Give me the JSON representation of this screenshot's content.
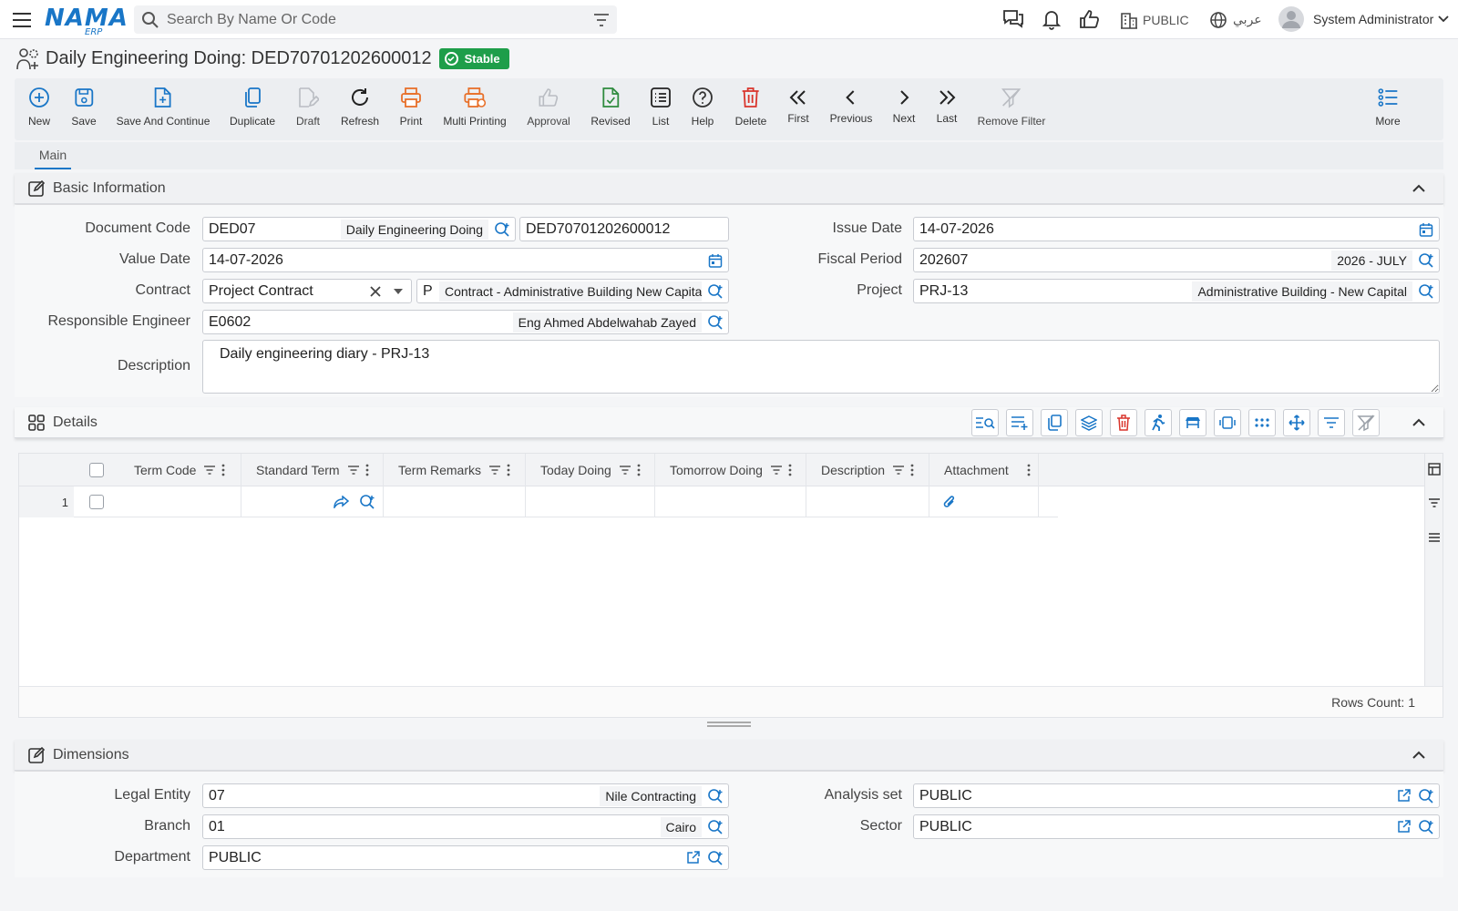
{
  "app": {
    "logo": "NAMA",
    "logo_sub": "ERP",
    "search_placeholder": "Search By Name Or Code",
    "org": "PUBLIC",
    "language": "عربي",
    "user": "System Administrator"
  },
  "page": {
    "title": "Daily Engineering Doing: DED70701202600012",
    "status": "Stable"
  },
  "toolbar": {
    "new": "New",
    "save": "Save",
    "save_continue": "Save And Continue",
    "duplicate": "Duplicate",
    "draft": "Draft",
    "refresh": "Refresh",
    "print": "Print",
    "multi_printing": "Multi Printing",
    "approval": "Approval",
    "revised": "Revised",
    "list": "List",
    "help": "Help",
    "delete": "Delete",
    "first": "First",
    "previous": "Previous",
    "next": "Next",
    "last": "Last",
    "remove_filter": "Remove Filter",
    "more": "More"
  },
  "tabs": {
    "main": "Main"
  },
  "basic": {
    "title": "Basic Information",
    "document_code": {
      "label": "Document Code",
      "code": "DED07",
      "name": "Daily Engineering Doing",
      "number": "DED70701202600012"
    },
    "issue_date": {
      "label": "Issue Date",
      "value": "14-07-2026"
    },
    "value_date": {
      "label": "Value Date",
      "value": "14-07-2026"
    },
    "fiscal_period": {
      "label": "Fiscal Period",
      "value": "202607",
      "name": "2026 - JULY"
    },
    "contract": {
      "label": "Contract",
      "type": "Project Contract",
      "prefix": "P",
      "name": "Contract - Administrative Building New Capital"
    },
    "project": {
      "label": "Project",
      "value": "PRJ-13",
      "name": "Administrative Building - New Capital"
    },
    "engineer": {
      "label": "Responsible Engineer",
      "value": "E0602",
      "name": "Eng Ahmed Abdelwahab Zayed"
    },
    "description": {
      "label": "Description",
      "value": "Daily engineering diary - PRJ-13"
    }
  },
  "details": {
    "title": "Details",
    "columns": [
      "Term Code",
      "Standard Term",
      "Term Remarks",
      "Today Doing",
      "Tomorrow Doing",
      "Description",
      "Attachment"
    ],
    "rows": [
      {
        "index": "1"
      }
    ],
    "rows_count": "Rows Count: 1"
  },
  "dimensions": {
    "title": "Dimensions",
    "legal_entity": {
      "label": "Legal Entity",
      "value": "07",
      "name": "Nile Contracting"
    },
    "analysis_set": {
      "label": "Analysis set",
      "value": "PUBLIC"
    },
    "branch": {
      "label": "Branch",
      "value": "01",
      "name": "Cairo"
    },
    "sector": {
      "label": "Sector",
      "value": "PUBLIC"
    },
    "department": {
      "label": "Department",
      "value": "PUBLIC"
    }
  },
  "colors": {
    "accent": "#1976c7",
    "success": "#1e9e4a",
    "danger": "#d9342b",
    "print": "#e8702a",
    "revised": "#2e8b3e"
  }
}
